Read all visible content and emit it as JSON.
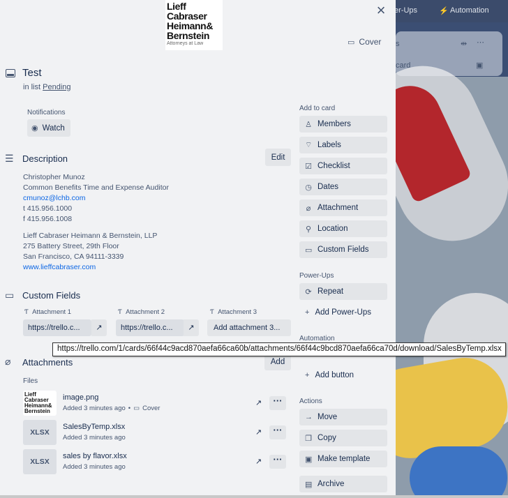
{
  "background": {
    "top_tabs": [
      "er-Ups",
      "Automation"
    ],
    "list_suffix": "s",
    "list_card": "card"
  },
  "logo": {
    "lines": [
      "Lieff",
      "Cabraser",
      "Heimann&",
      "Bernstein"
    ],
    "tagline": "Attorneys at Law"
  },
  "header": {
    "cover_label": "Cover",
    "title": "Test",
    "in_list_prefix": "in list",
    "list_name": "Pending"
  },
  "notifications": {
    "heading": "Notifications",
    "watch_label": "Watch"
  },
  "description": {
    "heading": "Description",
    "edit_label": "Edit",
    "lines": [
      "Christopher Munoz",
      "Common Benefits Time and Expense Auditor",
      "cmunoz@lchb.com",
      "t 415.956.1000",
      "f 415.956.1008",
      "Lieff Cabraser Heimann & Bernstein, LLP",
      "275 Battery Street, 29th Floor",
      "San Francisco, CA 94111-3339",
      "www.lieffcabraser.com"
    ]
  },
  "custom_fields": {
    "heading": "Custom Fields",
    "fields": [
      {
        "label": "Attachment 1",
        "value": "https://trello.c..."
      },
      {
        "label": "Attachment 2",
        "value": "https://trello.c..."
      },
      {
        "label": "Attachment 3",
        "value": "Add attachment 3..."
      }
    ]
  },
  "tooltip": "https://trello.com/1/cards/66f44c9acd870aefa66ca60b/attachments/66f44c9bcd870aefa66ca70d/download/SalesByTemp.xlsx",
  "attachments": {
    "heading": "Attachments",
    "add_label": "Add",
    "files_heading": "Files",
    "files": [
      {
        "name": "image.png",
        "meta": "Added 3 minutes ago",
        "extra": "Cover",
        "thumb": ""
      },
      {
        "name": "SalesByTemp.xlsx",
        "meta": "Added 3 minutes ago",
        "extra": "",
        "thumb": "XLSX"
      },
      {
        "name": "sales by flavor.xlsx",
        "meta": "Added 3 minutes ago",
        "extra": "",
        "thumb": "XLSX"
      }
    ]
  },
  "sidebar": {
    "add_to_card_heading": "Add to card",
    "add_to_card": [
      {
        "label": "Members",
        "icon": "person-icon"
      },
      {
        "label": "Labels",
        "icon": "tag-icon"
      },
      {
        "label": "Checklist",
        "icon": "checkbox-icon"
      },
      {
        "label": "Dates",
        "icon": "clock-icon"
      },
      {
        "label": "Attachment",
        "icon": "paperclip-icon"
      },
      {
        "label": "Location",
        "icon": "pin-icon"
      },
      {
        "label": "Custom Fields",
        "icon": "fields-icon"
      }
    ],
    "powerups_heading": "Power-Ups",
    "repeat_label": "Repeat",
    "add_powerups_label": "Add Power-Ups",
    "automation_heading": "Automation",
    "add_button_label": "Add button",
    "actions_heading": "Actions",
    "actions": [
      {
        "label": "Move",
        "icon": "arrow-right-icon"
      },
      {
        "label": "Copy",
        "icon": "copy-icon"
      },
      {
        "label": "Make template",
        "icon": "template-icon"
      },
      {
        "label": "Archive",
        "icon": "archive-icon"
      }
    ]
  }
}
